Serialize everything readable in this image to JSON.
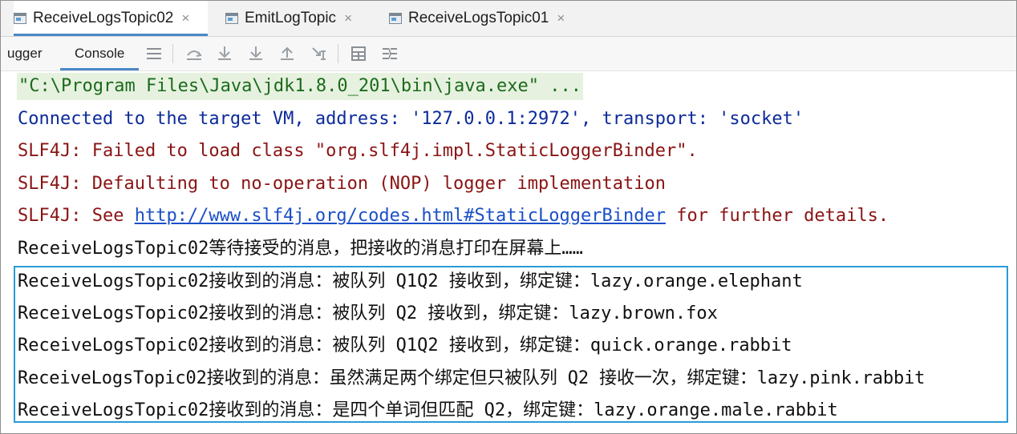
{
  "tabs": [
    {
      "label": "ReceiveLogsTopic02",
      "active": true
    },
    {
      "label": "EmitLogTopic",
      "active": false
    },
    {
      "label": "ReceiveLogsTopic01",
      "active": false
    }
  ],
  "tab_close_glyph": "×",
  "subtabs": {
    "debugger": "ugger",
    "console": "Console"
  },
  "toolbar_icons": [
    "hamburger-menu-icon",
    "step-over-icon",
    "step-into-icon",
    "force-step-into-icon",
    "step-out-icon",
    "run-to-cursor-icon",
    "evaluate-expression-icon",
    "trace-icon"
  ],
  "console": {
    "command": "\"C:\\Program Files\\Java\\jdk1.8.0_201\\bin\\java.exe\" ...",
    "connected": "Connected to the target VM, address: '127.0.0.1:2972', transport: 'socket'",
    "slf4j_failed": "SLF4J: Failed to load class \"org.slf4j.impl.StaticLoggerBinder\".",
    "slf4j_default": "SLF4J: Defaulting to no-operation (NOP) logger implementation",
    "slf4j_see_prefix": "SLF4J: See ",
    "slf4j_link": "http://www.slf4j.org/codes.html#StaticLoggerBinder",
    "slf4j_see_suffix": " for further details.",
    "waiting": "ReceiveLogsTopic02等待接受的消息，把接收的消息打印在屏幕上……",
    "received": [
      "ReceiveLogsTopic02接收到的消息：被队列 Q1Q2 接收到，绑定键：lazy.orange.elephant",
      "ReceiveLogsTopic02接收到的消息：被队列 Q2 接收到，绑定键：lazy.brown.fox",
      "ReceiveLogsTopic02接收到的消息：被队列 Q1Q2 接收到，绑定键：quick.orange.rabbit",
      "ReceiveLogsTopic02接收到的消息：虽然满足两个绑定但只被队列 Q2 接收一次，绑定键：lazy.pink.rabbit",
      "ReceiveLogsTopic02接收到的消息：是四个单词但匹配 Q2，绑定键：lazy.orange.male.rabbit"
    ]
  },
  "colors": {
    "tab_underline": "#4a88c7",
    "highlight_border": "#2a9bd6",
    "command_bg": "#e6f2df",
    "info_blue": "#0c2a9a",
    "error_red": "#8a1414",
    "link_blue": "#1a4fc7"
  }
}
